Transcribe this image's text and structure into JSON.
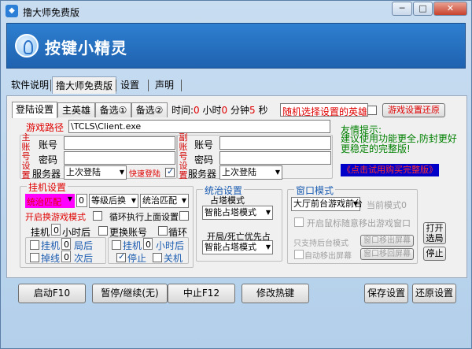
{
  "window": {
    "title": "撸大师免费版",
    "min": "─",
    "max": "□",
    "close": "✕"
  },
  "banner": {
    "title": "按键小精灵"
  },
  "menu": [
    "软件说明",
    "撸大师免费版",
    "设置",
    "声明"
  ],
  "tabs": [
    "登陆设置",
    "主英雄",
    "备选①",
    "备选②"
  ],
  "timer": {
    "label": "时间:",
    "hours": "0",
    "hours_unit": "小时",
    "minutes": "0",
    "minutes_unit": "分钟",
    "seconds": "5",
    "seconds_unit": "秒"
  },
  "random_hero": {
    "label": "随机选择设置的英雄"
  },
  "restore_game_settings": "游戏设置还原",
  "game_path": {
    "label": "游戏路径",
    "value": "\\TCLS\\Client.exe"
  },
  "main_account": {
    "side_label": [
      "主",
      "账",
      "号",
      "设",
      "置"
    ],
    "account_label": "账号",
    "password_label": "密码",
    "server_label": "服务器",
    "server_value": "上次登陆",
    "quick_login": "快速登陆"
  },
  "sub_account": {
    "side_label": [
      "副",
      "账",
      "号",
      "设",
      "置"
    ],
    "account_label": "账号",
    "password_label": "密码",
    "server_label": "服务器",
    "server_value": "上次登陆"
  },
  "tips": {
    "title": "友情提示:",
    "text": "建议使用功能更全,防封更好更稳定的完整版!",
    "link": "《点击试用购买完整版》"
  },
  "hangup": {
    "title": "挂机设置",
    "mode_value": "统治匹配",
    "count_value": "0",
    "level_mode": "等级后换",
    "mode2": "统治匹配",
    "open_game_mode": "开启换游戏模式",
    "loop_exec": "循环执行上面设置",
    "hang_label": "挂机",
    "hang_hours": "0",
    "hang_after": "小时后",
    "change_account": "更换账号",
    "loop": "循环",
    "row1_a": "挂机",
    "row1_b": "0",
    "row1_c": "局后",
    "row1_d": "挂机",
    "row1_e": "0",
    "row1_f": "小时后",
    "row2_a": "掉线",
    "row2_b": "0",
    "row2_c": "次后",
    "row2_d": "停止",
    "row2_e": "关机"
  },
  "rule": {
    "title": "统治设置",
    "tower_label": "占塔模式",
    "tower_value": "智能占塔模式",
    "open_close_label": "开局/死亡优先占",
    "open_close_value": "智能占塔模式"
  },
  "window_mode": {
    "title": "窗口模式",
    "front_value": "大厅前台游戏前台",
    "mode_label": "当前模式0",
    "auto_move": "开启鼠标随意移出游戏窗口",
    "hint": "只支持后台模式",
    "auto_out": "自动移出屏幕",
    "move_out_btn": "窗口移出屏幕",
    "move_back_btn": "窗口移回屏幕"
  },
  "open_lobby": "打开\n选局",
  "stop_btn": "停止",
  "bottom": {
    "start": "启动F10",
    "pause": "暂停/继续(无)",
    "abort": "中止F12",
    "hotkey": "修改热键",
    "save": "保存设置",
    "restore": "还原设置"
  }
}
